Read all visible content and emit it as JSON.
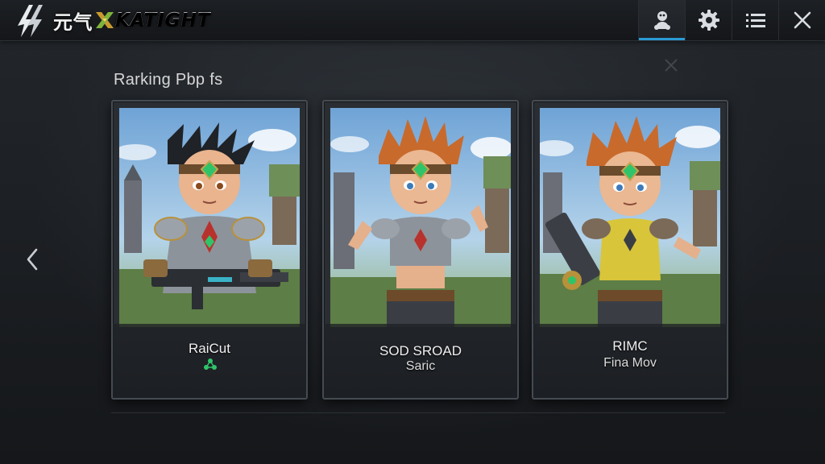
{
  "app": {
    "logo_text_cn": "元气",
    "logo_text_en": "KATIGHT"
  },
  "topbar": {
    "buttons": [
      {
        "icon": "character-icon",
        "active": true
      },
      {
        "icon": "gear-icon",
        "active": false
      },
      {
        "icon": "menu-icon",
        "active": false
      },
      {
        "icon": "close-icon",
        "active": false
      }
    ],
    "accent": "#2b9bd6"
  },
  "section": {
    "title": "Rarking Pbp fs"
  },
  "cards": [
    {
      "name": "RaiCut",
      "sub": "",
      "badge_color": "#2fc46a",
      "hair": "black"
    },
    {
      "name": "SOD SROAD",
      "sub": "Saric",
      "hair": "orange"
    },
    {
      "name": "RIMC",
      "sub": "Fina Mov",
      "hair": "orange"
    }
  ],
  "nav": {
    "prev_icon": "chevron-left-icon"
  }
}
